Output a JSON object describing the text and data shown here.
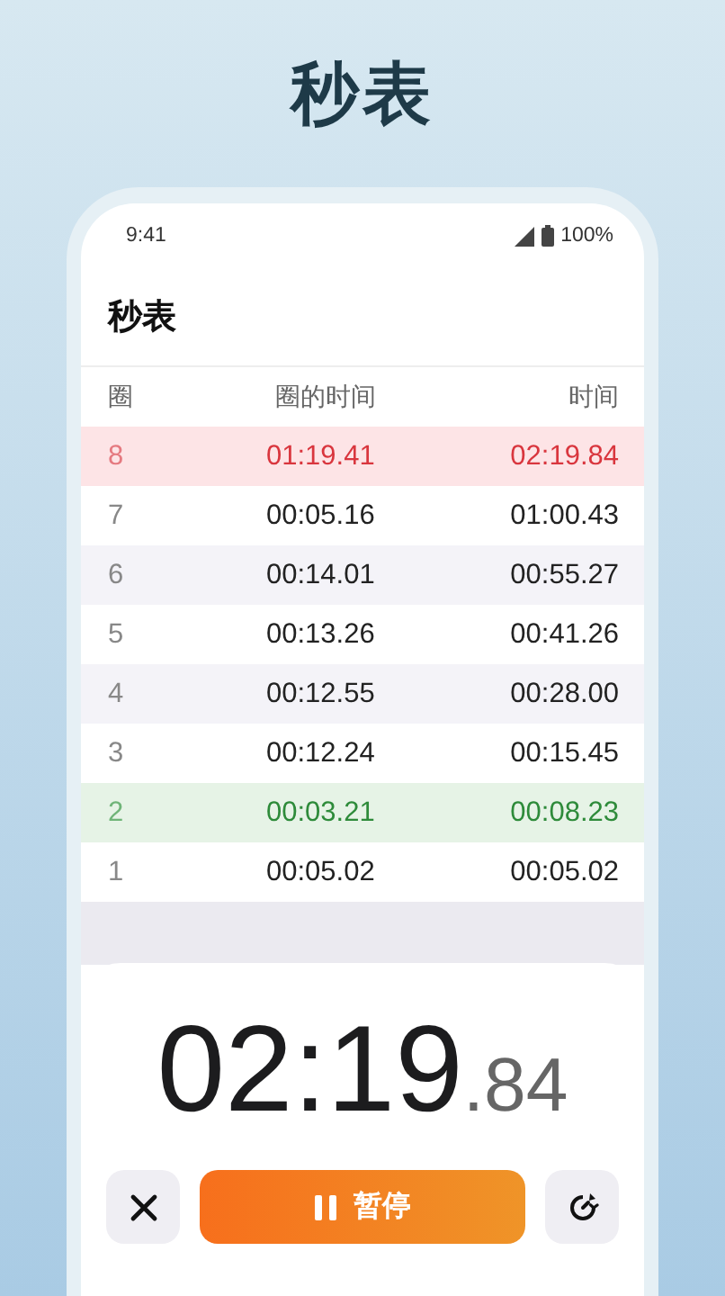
{
  "headline": "秒表",
  "status_bar": {
    "time": "9:41",
    "battery": "100%"
  },
  "screen_title": "秒表",
  "columns": [
    "圈",
    "圈的时间",
    "时间"
  ],
  "laps": [
    {
      "lap": "8",
      "lap_time": "01:19.41",
      "total": "02:19.84",
      "kind": "slowest"
    },
    {
      "lap": "7",
      "lap_time": "00:05.16",
      "total": "01:00.43",
      "kind": "normal"
    },
    {
      "lap": "6",
      "lap_time": "00:14.01",
      "total": "00:55.27",
      "kind": "normal"
    },
    {
      "lap": "5",
      "lap_time": "00:13.26",
      "total": "00:41.26",
      "kind": "normal"
    },
    {
      "lap": "4",
      "lap_time": "00:12.55",
      "total": "00:28.00",
      "kind": "normal"
    },
    {
      "lap": "3",
      "lap_time": "00:12.24",
      "total": "00:15.45",
      "kind": "normal"
    },
    {
      "lap": "2",
      "lap_time": "00:03.21",
      "total": "00:08.23",
      "kind": "fastest"
    },
    {
      "lap": "1",
      "lap_time": "00:05.02",
      "total": "00:05.02",
      "kind": "normal"
    }
  ],
  "display": {
    "main": "02:19",
    "fraction": ".84"
  },
  "pause_button": {
    "label": "暂停"
  }
}
